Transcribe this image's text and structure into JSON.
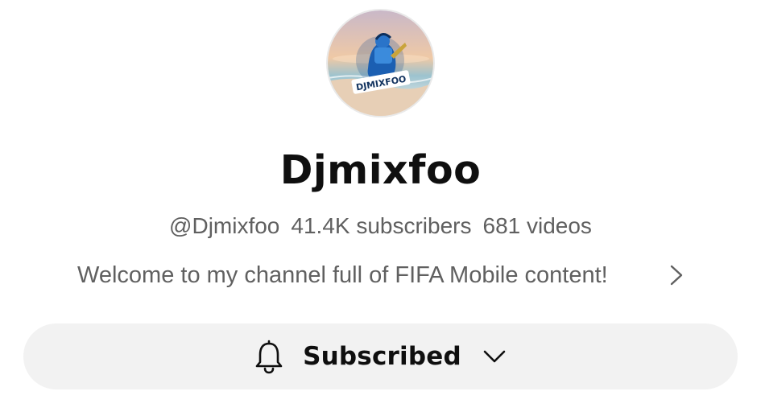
{
  "channel": {
    "avatar_logo_text": "DJMIXFOO",
    "name": "Djmixfoo",
    "handle": "@Djmixfoo",
    "subscribers": "41.4K subscribers",
    "videos": "681 videos",
    "description": "Welcome to my channel full of FIFA Mobile content!"
  },
  "subscribe": {
    "label": "Subscribed",
    "state": "subscribed"
  },
  "icons": {
    "description_more": "chevron-right-icon",
    "bell": "bell-icon",
    "dropdown": "chevron-down-icon"
  },
  "colors": {
    "text_primary": "#0f0f0f",
    "text_secondary": "#606060",
    "button_bg": "#f2f2f2",
    "background": "#ffffff"
  }
}
